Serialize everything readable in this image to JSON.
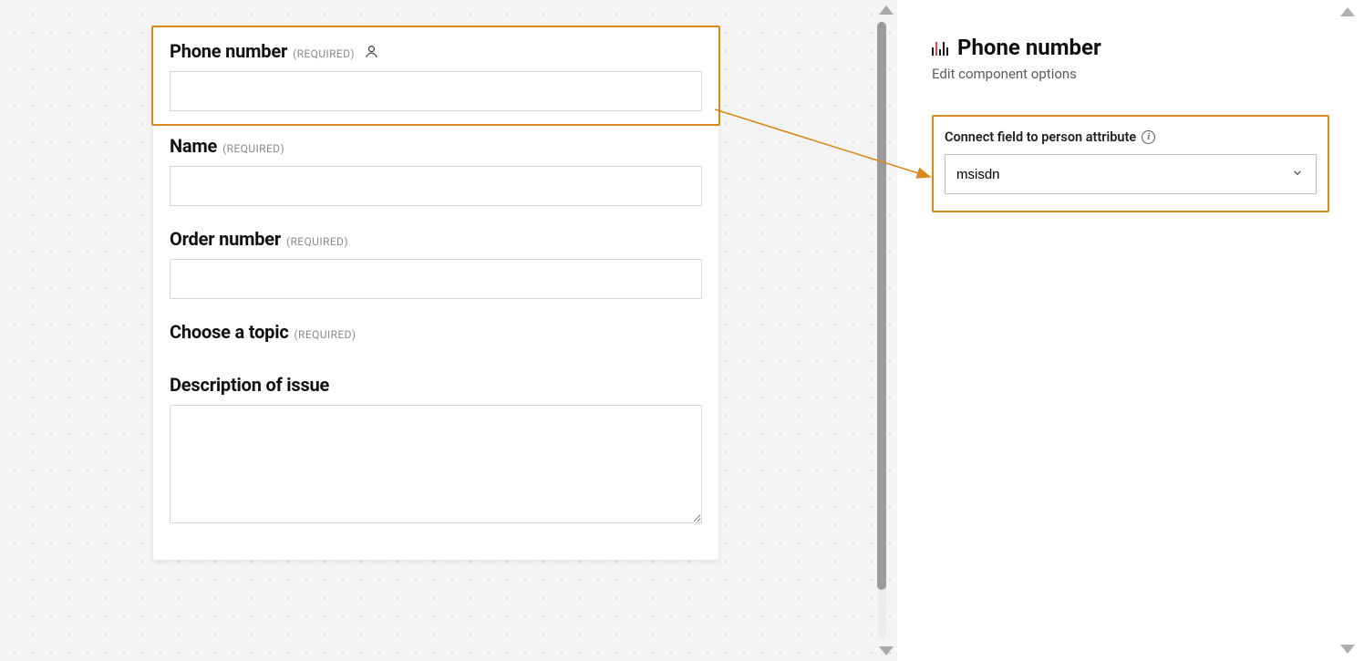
{
  "form": {
    "fields": [
      {
        "label": "Phone number",
        "required_tag": "(REQUIRED)",
        "has_person_icon": true,
        "selected": true,
        "type": "text"
      },
      {
        "label": "Name",
        "required_tag": "(REQUIRED)",
        "has_person_icon": false,
        "selected": false,
        "type": "text"
      },
      {
        "label": "Order number",
        "required_tag": "(REQUIRED)",
        "has_person_icon": false,
        "selected": false,
        "type": "text"
      },
      {
        "label": "Choose a topic",
        "required_tag": "(REQUIRED)",
        "has_person_icon": false,
        "selected": false,
        "type": "none"
      },
      {
        "label": "Description of issue",
        "required_tag": "",
        "has_person_icon": false,
        "selected": false,
        "type": "textarea"
      }
    ]
  },
  "panel": {
    "title": "Phone number",
    "subtitle": "Edit component options",
    "attribute_section": {
      "label": "Connect field to person attribute",
      "selected_value": "msisdn"
    }
  },
  "colors": {
    "highlight": "#d68a1e"
  }
}
